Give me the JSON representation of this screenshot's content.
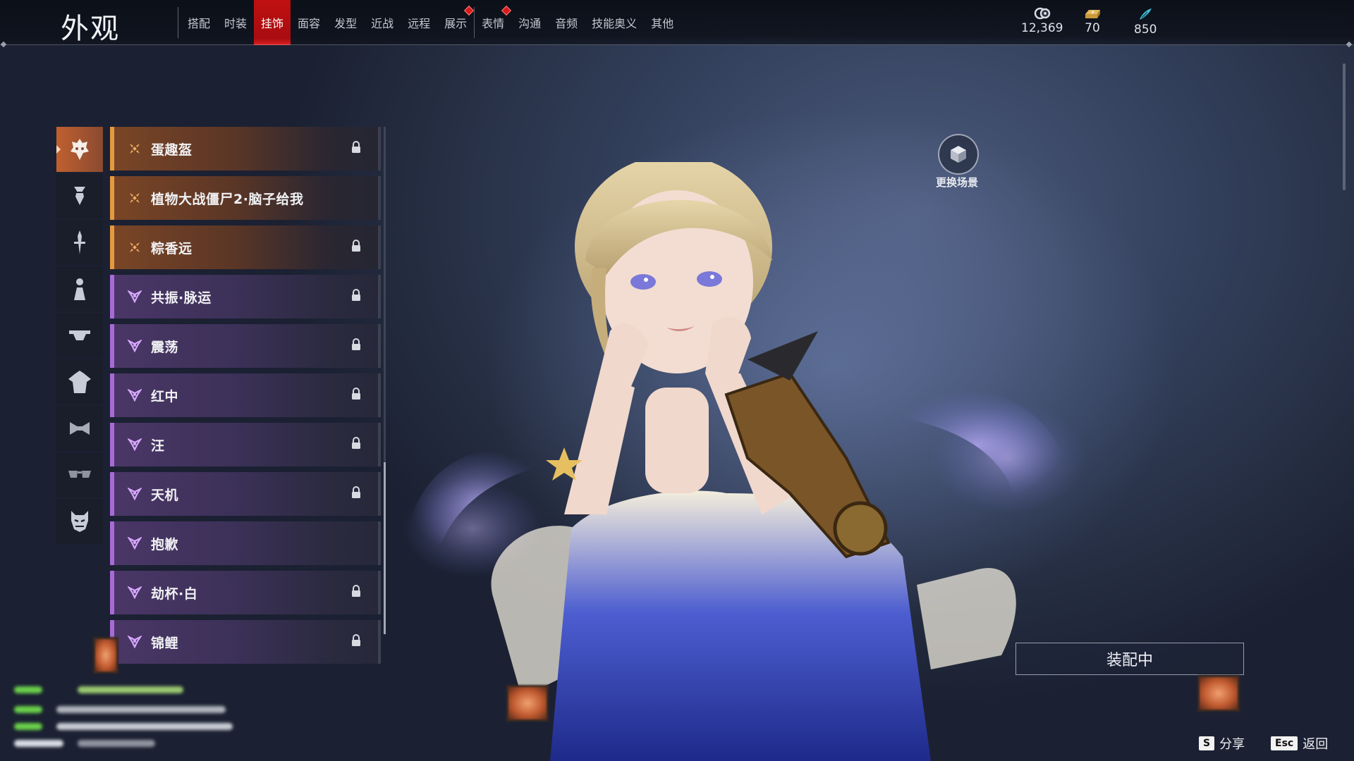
{
  "header": {
    "title": "外观",
    "tabs": [
      {
        "label": "搭配",
        "active": false,
        "dot": false
      },
      {
        "label": "时装",
        "active": false,
        "dot": false
      },
      {
        "label": "挂饰",
        "active": true,
        "dot": false
      },
      {
        "label": "面容",
        "active": false,
        "dot": false
      },
      {
        "label": "发型",
        "active": false,
        "dot": false
      },
      {
        "label": "近战",
        "active": false,
        "dot": false
      },
      {
        "label": "远程",
        "active": false,
        "dot": false
      },
      {
        "label": "展示",
        "active": false,
        "dot": true
      },
      {
        "label": "表情",
        "active": false,
        "dot": true
      },
      {
        "label": "沟通",
        "active": false,
        "dot": false
      },
      {
        "label": "音频",
        "active": false,
        "dot": false
      },
      {
        "label": "技能奥义",
        "active": false,
        "dot": false
      },
      {
        "label": "其他",
        "active": false,
        "dot": false
      }
    ],
    "currencies": [
      {
        "icon": "coin-icon",
        "value": "12,369"
      },
      {
        "icon": "gold-bar-icon",
        "value": "70"
      },
      {
        "icon": "jade-feather-icon",
        "value": "850"
      }
    ]
  },
  "categories": [
    {
      "icon": "mask-icon",
      "active": true
    },
    {
      "icon": "bird-icon",
      "active": false
    },
    {
      "icon": "sword-hilt-icon",
      "active": false
    },
    {
      "icon": "figure-icon",
      "active": false
    },
    {
      "icon": "hat-icon",
      "active": false
    },
    {
      "icon": "cloak-icon",
      "active": false
    },
    {
      "icon": "bow-tie-icon",
      "active": false
    },
    {
      "icon": "glasses-icon",
      "active": false
    },
    {
      "icon": "demon-face-icon",
      "active": false
    }
  ],
  "items": [
    {
      "name": "蛋趣盔",
      "rarity": "orange",
      "locked": true
    },
    {
      "name": "植物大战僵尸2·脑子给我",
      "rarity": "orange",
      "locked": false
    },
    {
      "name": "粽香远",
      "rarity": "orange",
      "locked": true
    },
    {
      "name": "共振·脉运",
      "rarity": "purple",
      "locked": true
    },
    {
      "name": "震荡",
      "rarity": "purple",
      "locked": true
    },
    {
      "name": "红中",
      "rarity": "purple",
      "locked": true
    },
    {
      "name": "汪",
      "rarity": "purple",
      "locked": true
    },
    {
      "name": "天机",
      "rarity": "purple",
      "locked": true
    },
    {
      "name": "抱歉",
      "rarity": "purple",
      "locked": false
    },
    {
      "name": "劫杯·白",
      "rarity": "purple",
      "locked": true
    },
    {
      "name": "锦鲤",
      "rarity": "purple",
      "locked": true
    }
  ],
  "scene_button": {
    "label": "更换场景",
    "icon": "cube-icon"
  },
  "equip_button": {
    "label": "装配中"
  },
  "hints": [
    {
      "key": "S",
      "label": "分享"
    },
    {
      "key": "Esc",
      "label": "返回"
    }
  ],
  "colors": {
    "accent_red": "#c01010",
    "orange_rarity": "#e59a3e",
    "purple_rarity": "#a86ad8"
  }
}
